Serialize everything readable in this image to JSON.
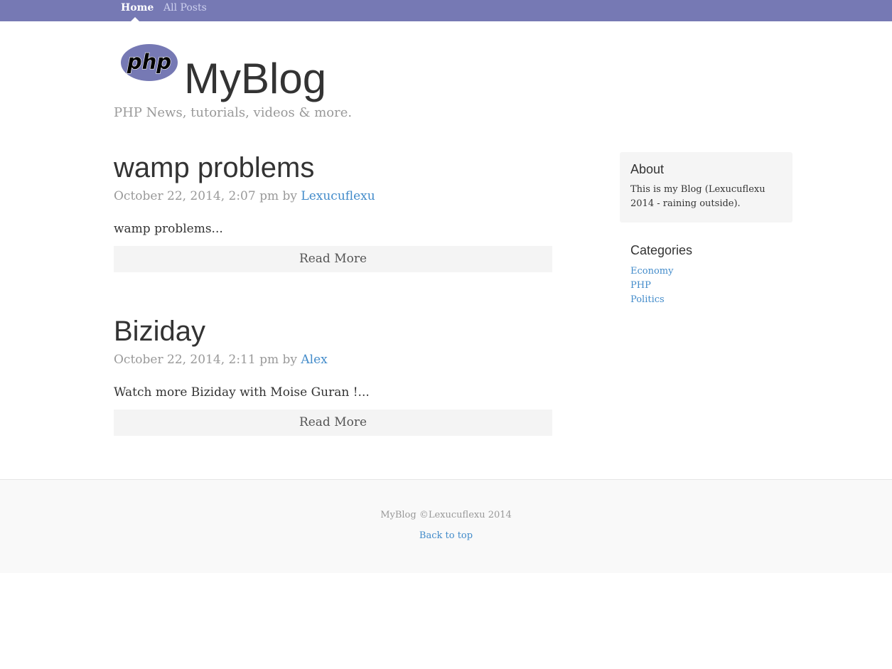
{
  "nav": {
    "items": [
      {
        "label": "Home",
        "active": true
      },
      {
        "label": "All Posts",
        "active": false
      }
    ]
  },
  "header": {
    "logo_text": "php",
    "site_title": "MyBlog",
    "description": "PHP News, tutorials, videos & more."
  },
  "posts": [
    {
      "title": "wamp problems",
      "date": "October 22, 2014, 2:07 pm",
      "by": "by",
      "author": "Lexucuflexu",
      "excerpt": "wamp problems...",
      "read_more": "Read More"
    },
    {
      "title": "Biziday",
      "date": "October 22, 2014, 2:11 pm",
      "by": "by",
      "author": "Alex",
      "excerpt": "Watch more Biziday with Moise Guran !...",
      "read_more": "Read More"
    }
  ],
  "sidebar": {
    "about": {
      "heading": "About",
      "text": "This is my Blog (Lexucuflexu 2014 - raining outside)."
    },
    "categories": {
      "heading": "Categories",
      "items": [
        "Economy",
        "PHP",
        "Politics"
      ]
    }
  },
  "footer": {
    "copyright": "MyBlog ©Lexucuflexu 2014",
    "back_to_top": "Back to top"
  },
  "colors": {
    "nav_bg": "#7679b4",
    "link": "#428bca",
    "muted": "#999999"
  }
}
